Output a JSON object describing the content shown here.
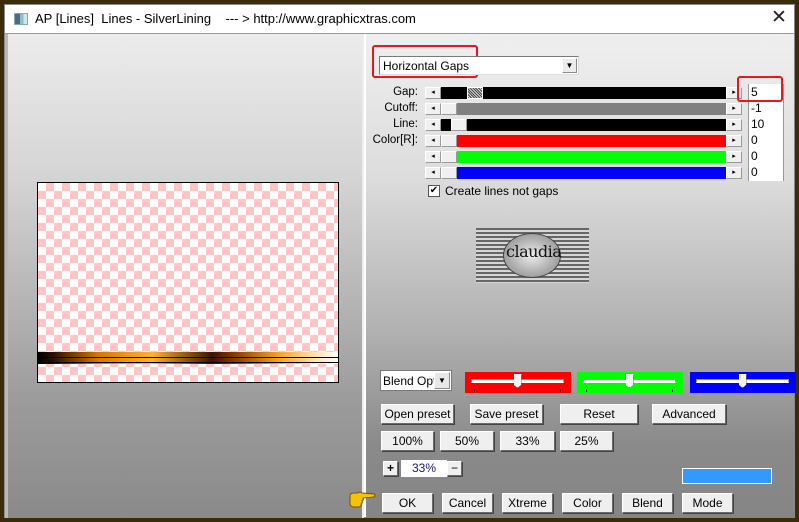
{
  "window": {
    "title": "AP [Lines]  Lines - SilverLining    --- > http://www.graphicxtras.com",
    "close_label": "✕"
  },
  "mode_select": {
    "value": "Horizontal Gaps",
    "arrow": "▼"
  },
  "sliders": [
    {
      "label": "Gap:",
      "value": "5",
      "color": "#000000",
      "highlighted": true
    },
    {
      "label": "Cutoff:",
      "value": "-1",
      "color": "#808080"
    },
    {
      "label": "Line:",
      "value": "10",
      "color": "#000000"
    },
    {
      "label": "Color[R]:",
      "value": "0",
      "color": "#ff0000"
    },
    {
      "label": "",
      "value": "0",
      "color": "#00ff00"
    },
    {
      "label": "",
      "value": "0",
      "color": "#0000ff"
    }
  ],
  "scroll_arrows": {
    "left": "◂",
    "right": "▸"
  },
  "checkbox": {
    "label": "Create lines not gaps",
    "checked": true,
    "mark": "✔"
  },
  "logo": {
    "text": "claudia"
  },
  "blend_select": {
    "value": "Blend Options",
    "display": "Blend Opti",
    "arrow": "▼"
  },
  "color_sliders": [
    {
      "name": "red",
      "color": "#ff0000",
      "position": 0.5
    },
    {
      "name": "green",
      "color": "#00ff00",
      "position": 0.5
    },
    {
      "name": "blue",
      "color": "#0000ff",
      "position": 0.5
    }
  ],
  "preset_buttons": [
    "Open preset",
    "Save preset",
    "Reset",
    "Advanced"
  ],
  "zoom_buttons": [
    "100%",
    "50%",
    "33%",
    "25%"
  ],
  "zoom_control": {
    "plus": "+",
    "value": "33%",
    "minus": "−"
  },
  "swatch_color": "#3399ff",
  "action_buttons": [
    "OK",
    "Cancel",
    "Xtreme",
    "Color",
    "Blend",
    "Mode"
  ],
  "pointer_icon": "👉"
}
